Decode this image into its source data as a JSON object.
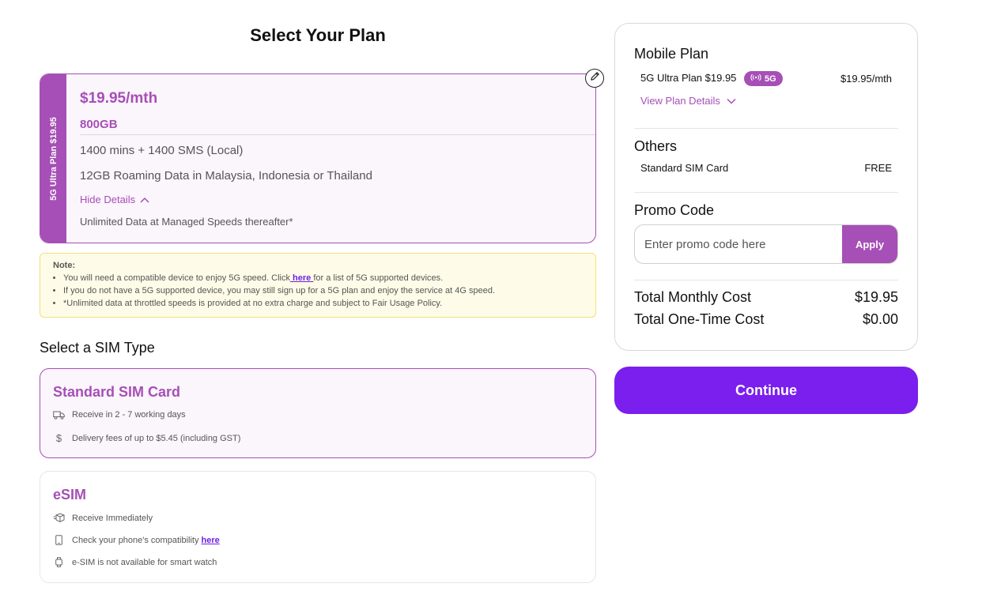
{
  "page_title": "Select Your Plan",
  "plan": {
    "side_label": "5G Ultra Plan $19.95",
    "price": "$19.95/mth",
    "data": "800GB",
    "line1": "1400 mins + 1400 SMS (Local)",
    "line2": "12GB Roaming Data in Malaysia, Indonesia or Thailand",
    "hide_details": "Hide Details",
    "unlimited": "Unlimited Data at Managed Speeds thereafter*"
  },
  "note": {
    "title": "Note:",
    "item1_before": "You will need a compatible device to enjoy 5G speed. Click",
    "item1_link": " here ",
    "item1_after": "for a list of 5G supported devices.",
    "item2": "If you do not have a 5G supported device, you may still sign up for a 5G plan and enjoy the service at 4G speed.",
    "item3": "*Unlimited data at throttled speeds is provided at no extra charge and subject to Fair Usage Policy."
  },
  "sim_section_title": "Select a SIM Type",
  "sim_standard": {
    "name": "Standard SIM Card",
    "row1": "Receive in 2 - 7 working days",
    "row2": "Delivery fees of up to $5.45 (including GST)"
  },
  "sim_esim": {
    "name": "eSIM",
    "row1": "Receive Immediately",
    "row2": "Check your phone's compatibility",
    "row2_link": "here",
    "row3": "e-SIM is not available for smart watch"
  },
  "summary": {
    "mobile_plan_heading": "Mobile Plan",
    "plan_name": "5G Ultra Plan $19.95",
    "badge": "5G",
    "plan_price": "$19.95/mth",
    "view_details": "View Plan Details",
    "others_heading": "Others",
    "others_item": "Standard SIM Card",
    "others_price": "FREE",
    "promo_heading": "Promo Code",
    "promo_placeholder": "Enter promo code here",
    "apply_label": "Apply",
    "total_monthly_label": "Total Monthly Cost",
    "total_monthly_value": "$19.95",
    "total_onetime_label": "Total One-Time Cost",
    "total_onetime_value": "$0.00"
  },
  "continue_label": "Continue",
  "colors": {
    "brand_purple": "#a64fb6",
    "cta_purple": "#7a1fee",
    "note_bg": "#fefce8"
  }
}
